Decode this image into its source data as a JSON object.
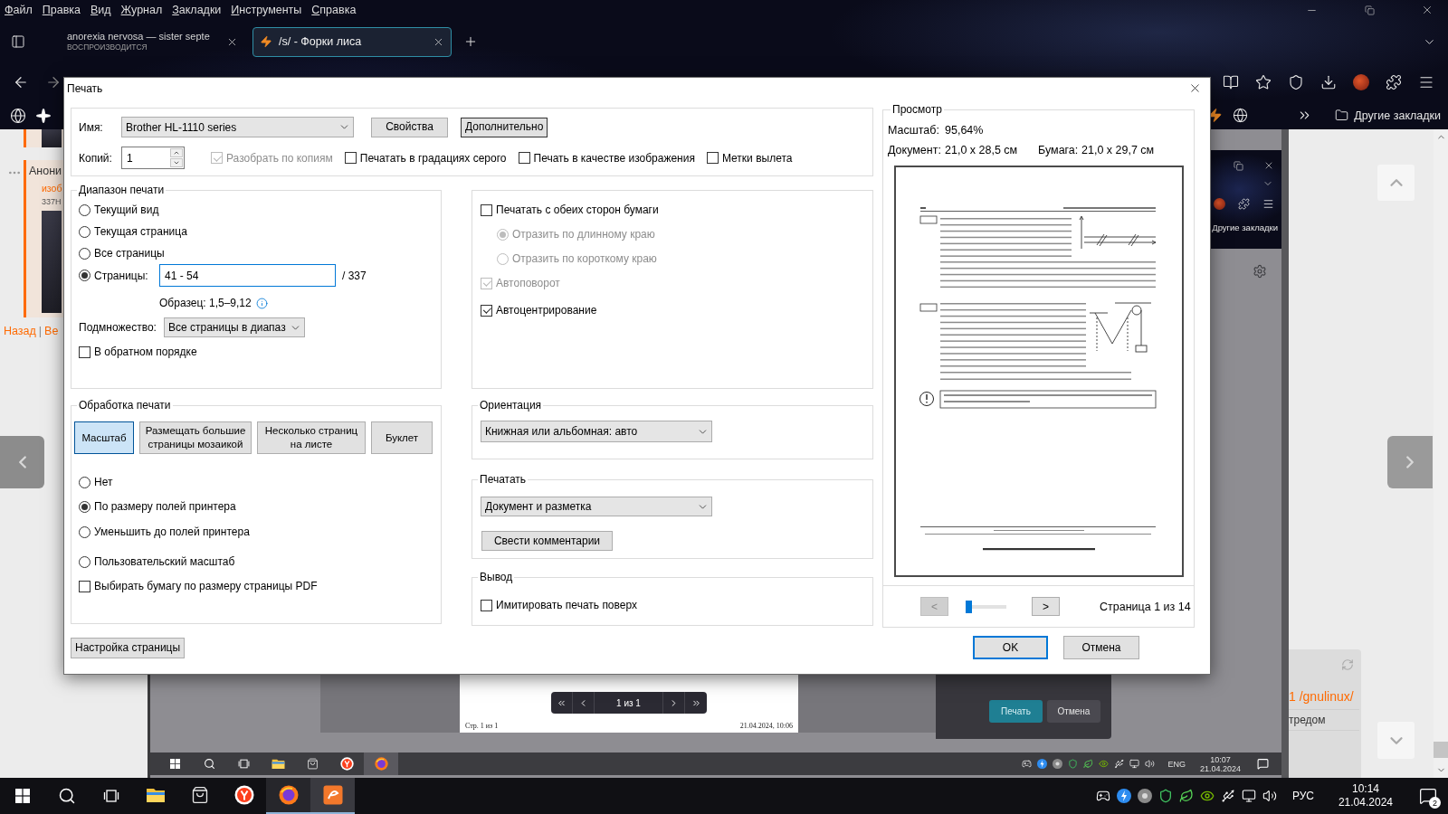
{
  "menu_bar": {
    "items": [
      "Файл",
      "Правка",
      "Вид",
      "Журнал",
      "Закладки",
      "Инструменты",
      "Справка"
    ]
  },
  "tabs": [
    {
      "kind": "media",
      "title": "anorexia nervosa — sister septe",
      "subtitle": "ВОСПРОИЗВОДИТСЯ",
      "selected": false
    },
    {
      "kind": "site",
      "title": "/s/ - Форки лиса",
      "selected": true
    }
  ],
  "bookmarks_bar": {
    "folder": "Другие закладки"
  },
  "page": {
    "post": {
      "author": "Анони",
      "file_link": "изоб",
      "file_info": "337Н"
    },
    "nav": {
      "back": "Назад",
      "separator": "|",
      "next": "Ве"
    },
    "side_panel": {
      "board_link": "1 /gnulinux/",
      "text": "тредом"
    }
  },
  "viewer_image": {
    "bookmarks_folder": "Другие закладки",
    "preview": {
      "footer_left": "Стр. 1 из 1",
      "footer_right": "21.04.2024, 10:06",
      "pager_label": "1 из 1"
    },
    "buttons": [
      {
        "label": "Печать",
        "primary": true
      },
      {
        "label": "Отмена",
        "primary": false
      }
    ],
    "taskbar": {
      "apps": [
        {
          "kind": "explorer",
          "selected": false
        },
        {
          "kind": "store",
          "selected": false
        },
        {
          "kind": "yandex",
          "selected": false
        },
        {
          "kind": "firefox",
          "selected": true
        }
      ],
      "language": "ENG",
      "time": "10:07",
      "date": "21.04.2024"
    }
  },
  "dialog": {
    "title": "Печать",
    "printer": {
      "name_label": "Имя:",
      "name": "Brother HL-1110 series",
      "buttons": [
        {
          "label": "Свойства",
          "focused": false
        },
        {
          "label": "Дополнительно",
          "focused": true
        }
      ],
      "copies_label": "Копий:",
      "copies": "1",
      "options": [
        {
          "label": "Разобрать по копиям",
          "checked": true,
          "disabled": true
        },
        {
          "label": "Печатать в градациях серого",
          "checked": false,
          "disabled": false
        },
        {
          "label": "Печать в качестве изображения",
          "checked": false,
          "disabled": false
        },
        {
          "label": "Метки вылета",
          "checked": false,
          "disabled": false
        }
      ]
    },
    "range": {
      "legend": "Диапазон печати",
      "options": [
        {
          "kind": "plain",
          "label": "Текущий вид",
          "selected": false
        },
        {
          "kind": "plain",
          "label": "Текущая страница",
          "selected": false
        },
        {
          "kind": "plain",
          "label": "Все страницы",
          "selected": false
        },
        {
          "kind": "pages",
          "label": "Страницы:",
          "selected": true,
          "value": "41 - 54",
          "total": "/ 337"
        }
      ],
      "sample": "Образец: 1,5–9,12",
      "subset_label": "Подмножество:",
      "subset": "Все страницы в диапаз",
      "reverse": {
        "label": "В обратном порядке",
        "checked": false
      }
    },
    "layout_options": [
      {
        "kind": "checkbox",
        "label": "Печатать с обеих сторон бумаги",
        "checked": false,
        "disabled": false,
        "children": [
          {
            "kind": "radio",
            "label": "Отразить по длинному краю",
            "selected": true,
            "disabled": true
          },
          {
            "kind": "radio",
            "label": "Отразить по короткому краю",
            "selected": false,
            "disabled": true
          }
        ]
      },
      {
        "kind": "checkbox",
        "label": "Автоповорот",
        "checked": true,
        "disabled": true
      },
      {
        "kind": "checkbox",
        "label": "Автоцентрирование",
        "checked": true,
        "disabled": false
      }
    ],
    "page_handling": {
      "legend": "Обработка печати",
      "modes": [
        {
          "label": "Масштаб",
          "selected": true
        },
        {
          "label": "Размещать большие\nстраницы мозаикой",
          "selected": false
        },
        {
          "label": "Несколько страниц\nна листе",
          "selected": false
        },
        {
          "label": "Буклет",
          "selected": false
        }
      ],
      "scaling": [
        {
          "label": "Нет",
          "selected": false
        },
        {
          "label": "По размеру полей принтера",
          "selected": true
        },
        {
          "label": "Уменьшить до полей принтера",
          "selected": false
        },
        {
          "label": "Пользовательский масштаб",
          "selected": false
        }
      ],
      "choose_paper": {
        "label": "Выбирать бумагу по размеру страницы PDF",
        "checked": false
      }
    },
    "orientation": {
      "legend": "Ориентация",
      "value": "Книжная или альбомная: авто"
    },
    "print_what": {
      "legend": "Печатать",
      "value": "Документ и разметка",
      "button": "Свести комментарии"
    },
    "output": {
      "legend": "Вывод",
      "option": {
        "label": "Имитировать печать поверх",
        "checked": false
      }
    },
    "page_setup_button": "Настройка страницы",
    "preview": {
      "legend": "Просмотр",
      "scale_label": "Масштаб:",
      "scale": "95,64%",
      "document_label": "Документ:",
      "document": "21,0 x 28,5 см",
      "paper_label": "Бумага:",
      "paper": "21,0 x 29,7 см",
      "prev_button": {
        "label": "<",
        "disabled": true
      },
      "slider": {
        "level": 0
      },
      "next_button": {
        "label": ">",
        "disabled": false
      },
      "page_label": "Страница 1 из 14"
    },
    "buttons": [
      {
        "label": "OK",
        "default": true
      },
      {
        "label": "Отмена",
        "default": false
      }
    ]
  },
  "taskbar": {
    "apps": [
      {
        "kind": "explorer",
        "running": false,
        "selected": false
      },
      {
        "kind": "store",
        "running": false,
        "selected": false
      },
      {
        "kind": "yandex",
        "running": false,
        "selected": false
      },
      {
        "kind": "firefox",
        "running": true,
        "selected": false
      },
      {
        "kind": "pdf",
        "running": true,
        "selected": true
      }
    ],
    "language": "РУС",
    "time": "10:14",
    "date": "21.04.2024",
    "notifications": "2"
  }
}
